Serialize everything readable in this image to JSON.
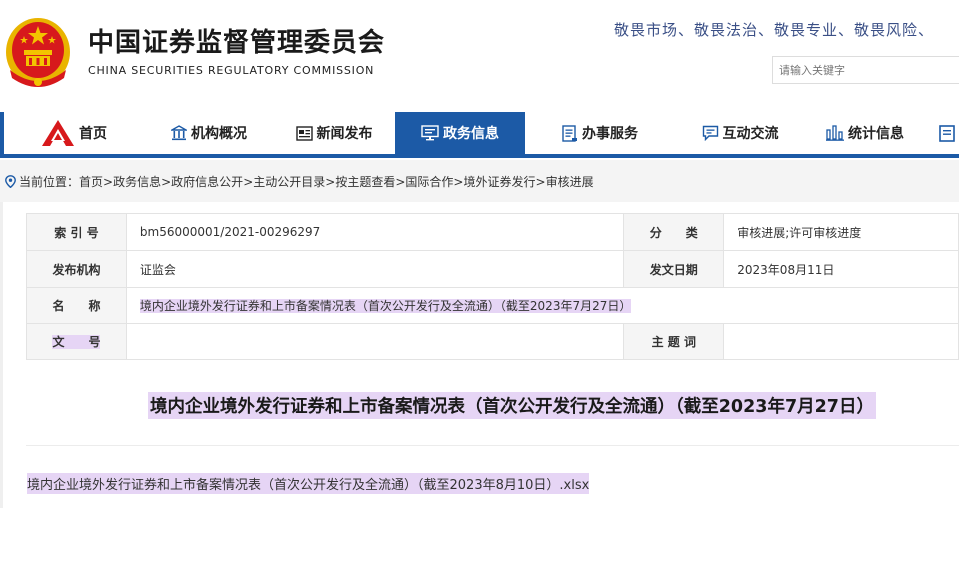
{
  "header": {
    "org_name_cn": "中国证券监督管理委员会",
    "org_name_en": "CHINA SECURITIES REGULATORY COMMISSION",
    "slogan": "敬畏市场、敬畏法治、敬畏专业、敬畏风险、",
    "search_placeholder": "请输入关键字"
  },
  "nav": {
    "items": [
      {
        "label": "首页",
        "icon": "home-logo-icon"
      },
      {
        "label": "机构概况",
        "icon": "building-icon"
      },
      {
        "label": "新闻发布",
        "icon": "newspaper-icon"
      },
      {
        "label": "政务信息",
        "icon": "monitor-icon"
      },
      {
        "label": "办事服务",
        "icon": "document-icon"
      },
      {
        "label": "互动交流",
        "icon": "chat-icon"
      },
      {
        "label": "统计信息",
        "icon": "bar-chart-icon"
      }
    ],
    "active_index": 3
  },
  "breadcrumb": {
    "prefix": "当前位置：",
    "items": [
      "首页",
      "政务信息",
      "政府信息公开",
      "主动公开目录",
      "按主题查看",
      "国际合作",
      "境外证券发行",
      "审核进展"
    ],
    "separator": " > "
  },
  "meta": {
    "index_label": "索 引 号",
    "index_value": "bm56000001/2021-00296297",
    "category_label": "分　　类",
    "category_value": "审核进展;许可审核进度",
    "publisher_label": "发布机构",
    "publisher_value": "证监会",
    "date_label": "发文日期",
    "date_value": "2023年08月11日",
    "name_label": "名　　称",
    "name_value": "境内企业境外发行证券和上市备案情况表（首次公开发行及全流通）（截至2023年7月27日）",
    "docno_label": "文　　号",
    "docno_value": "",
    "keyword_label": "主 题 词",
    "keyword_value": ""
  },
  "document": {
    "title": "境内企业境外发行证券和上市备案情况表（首次公开发行及全流通）（截至2023年7月27日）",
    "attachment": "境内企业境外发行证券和上市备案情况表（首次公开发行及全流通）（截至2023年8月10日）.xlsx"
  },
  "colors": {
    "brand_blue": "#1c5aa6",
    "highlight": "#e6d5f5",
    "emblem_red": "#d7191c",
    "emblem_gold": "#f3c400"
  }
}
